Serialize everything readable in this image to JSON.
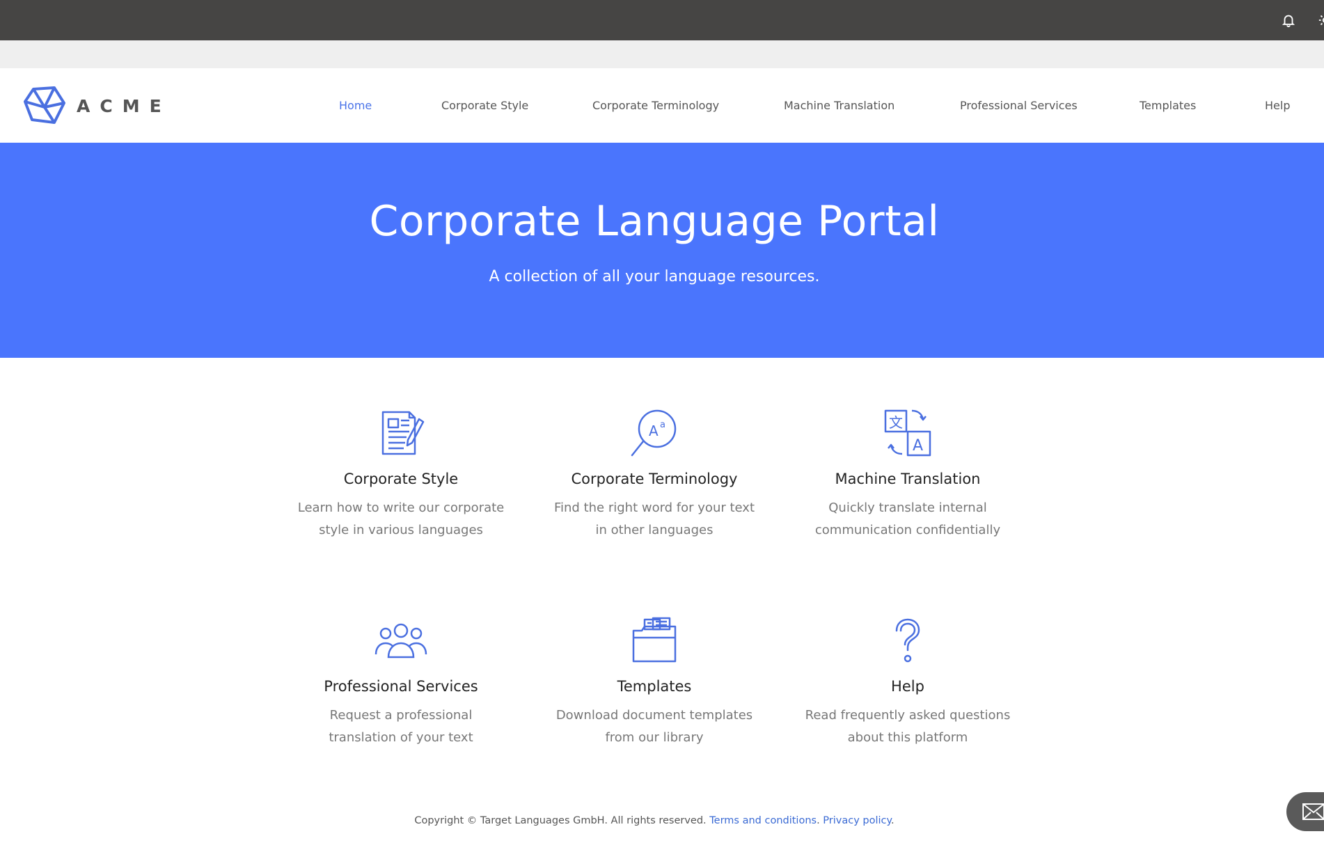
{
  "brand": {
    "name": "ACME",
    "accent": "#4a75fd",
    "logo_icon": "cube-logo-icon"
  },
  "topbar": {
    "icons": [
      "bell-icon",
      "gear-icon"
    ]
  },
  "nav": {
    "items": [
      {
        "label": "Home",
        "active": true
      },
      {
        "label": "Corporate Style",
        "active": false
      },
      {
        "label": "Corporate Terminology",
        "active": false
      },
      {
        "label": "Machine Translation",
        "active": false
      },
      {
        "label": "Professional Services",
        "active": false
      },
      {
        "label": "Templates",
        "active": false
      },
      {
        "label": "Help",
        "active": false
      }
    ]
  },
  "hero": {
    "title": "Corporate Language Portal",
    "subtitle": "A collection of all your language resources."
  },
  "cards": [
    {
      "icon": "document-pencil-icon",
      "title": "Corporate Style",
      "line1": "Learn how to write our corporate",
      "line2": "style in various languages"
    },
    {
      "icon": "magnifier-text-icon",
      "title": "Corporate Terminology",
      "line1": "Find the right word for your text",
      "line2": "in other languages"
    },
    {
      "icon": "translate-icon",
      "title": "Machine Translation",
      "line1": "Quickly translate internal",
      "line2": "communication confidentially"
    },
    {
      "icon": "people-group-icon",
      "title": "Professional Services",
      "line1": "Request a professional",
      "line2": "translation of your text"
    },
    {
      "icon": "folder-files-icon",
      "title": "Templates",
      "line1": "Download document templates",
      "line2": "from our library"
    },
    {
      "icon": "question-icon",
      "title": "Help",
      "line1": "Read frequently asked questions",
      "line2": "about this platform"
    }
  ],
  "footer": {
    "copyright": "Copyright © Target Languages GmbH. All rights reserved.",
    "terms": "Terms and conditions",
    "privacy": "Privacy policy",
    "sep": ".",
    "end": "."
  },
  "floating": {
    "icon": "mail-icon"
  }
}
